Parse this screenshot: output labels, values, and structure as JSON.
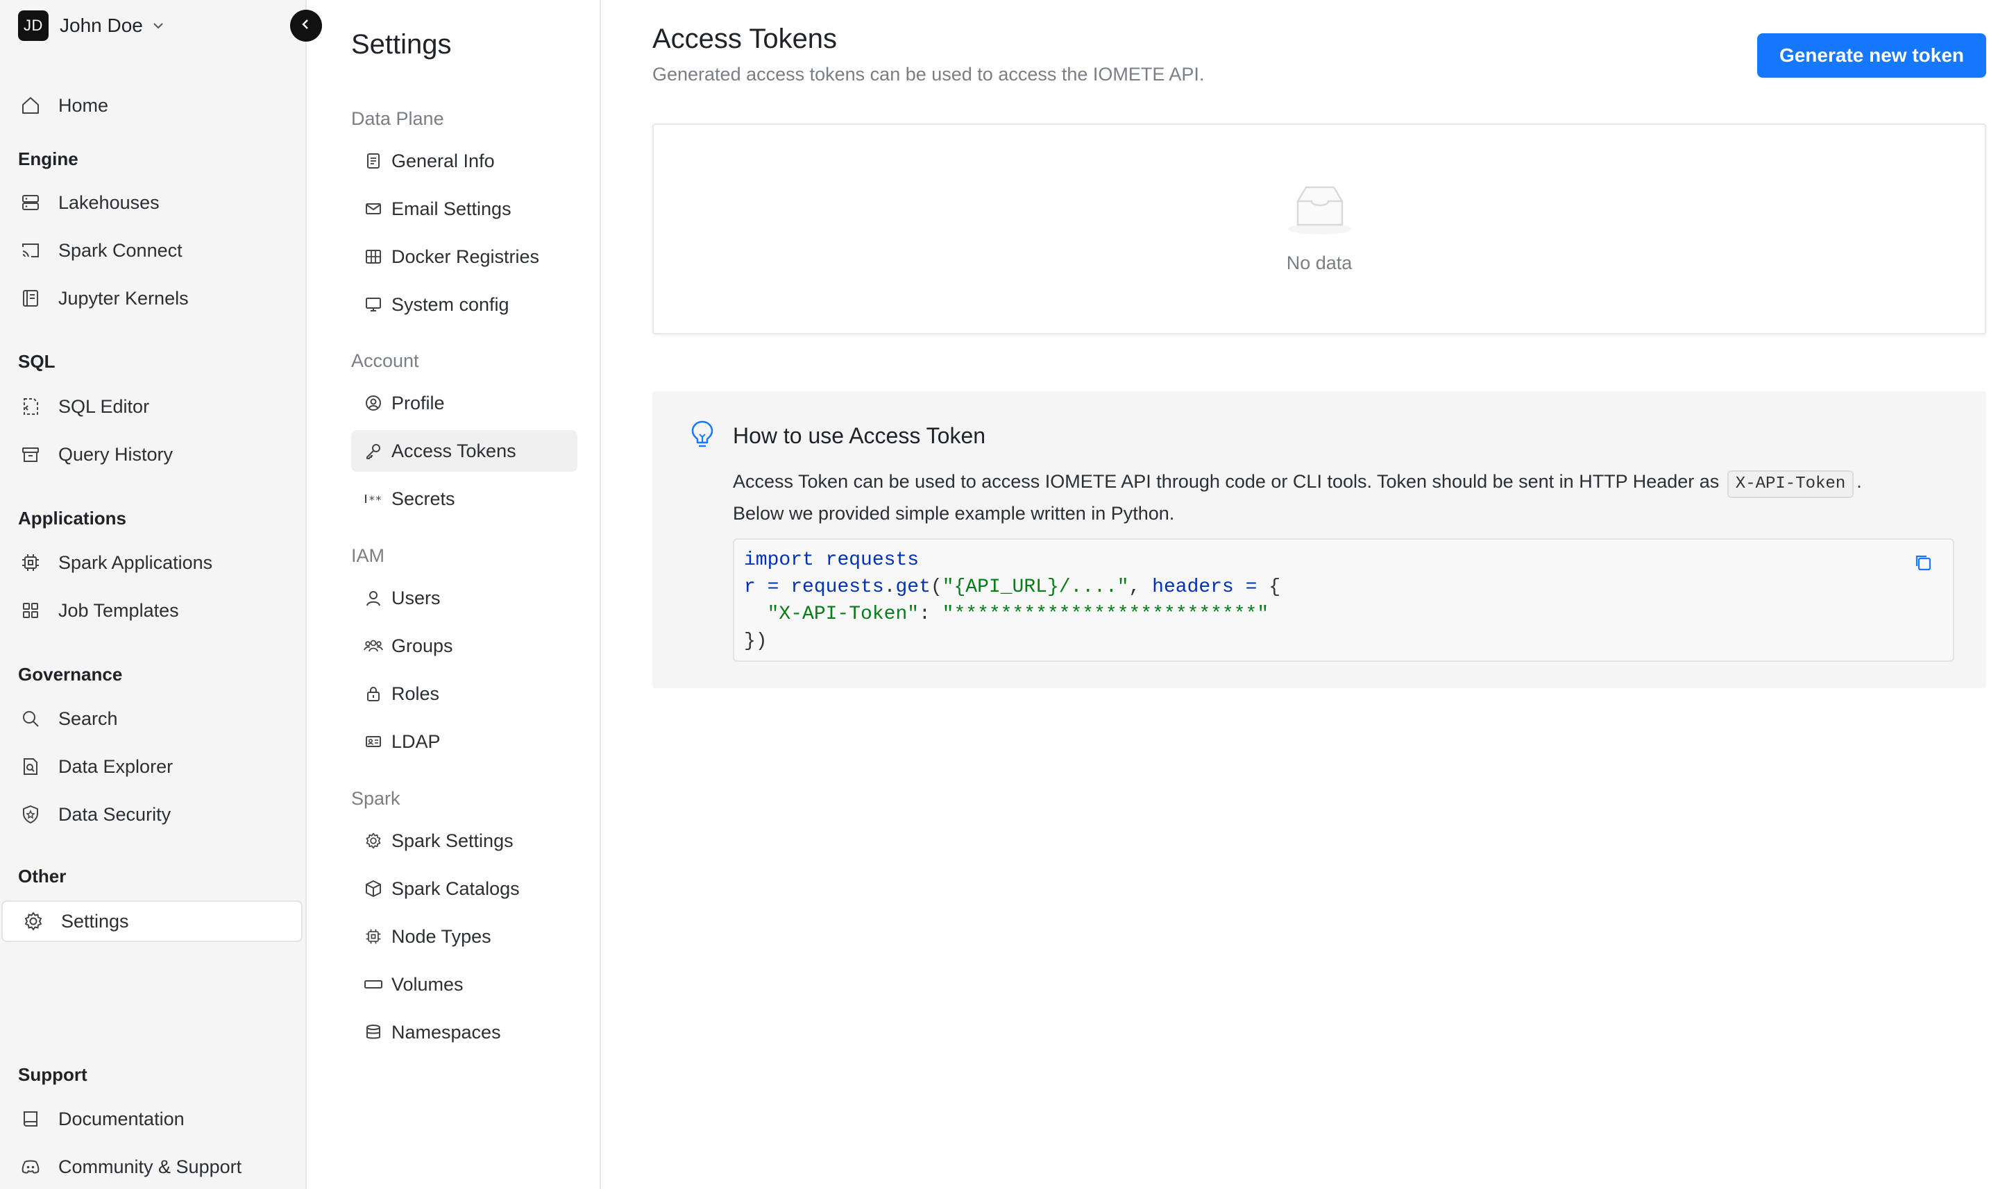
{
  "user": {
    "initials": "JD",
    "name": "John Doe"
  },
  "sidebar": {
    "home": "Home",
    "sections": {
      "engine": "Engine",
      "sql": "SQL",
      "applications": "Applications",
      "governance": "Governance",
      "other": "Other",
      "support": "Support"
    },
    "items": {
      "lakehouses": "Lakehouses",
      "spark_connect": "Spark Connect",
      "jupyter_kernels": "Jupyter Kernels",
      "sql_editor": "SQL Editor",
      "query_history": "Query History",
      "spark_applications": "Spark Applications",
      "job_templates": "Job Templates",
      "search": "Search",
      "data_explorer": "Data Explorer",
      "data_security": "Data Security",
      "settings": "Settings",
      "documentation": "Documentation",
      "community_support": "Community & Support"
    }
  },
  "settings_nav": {
    "title": "Settings",
    "groups": {
      "data_plane": "Data Plane",
      "account": "Account",
      "iam": "IAM",
      "spark": "Spark"
    },
    "items": {
      "general_info": "General Info",
      "email_settings": "Email Settings",
      "docker_registries": "Docker Registries",
      "system_config": "System config",
      "profile": "Profile",
      "access_tokens": "Access Tokens",
      "secrets": "Secrets",
      "users": "Users",
      "groups": "Groups",
      "roles": "Roles",
      "ldap": "LDAP",
      "spark_settings": "Spark Settings",
      "spark_catalogs": "Spark Catalogs",
      "node_types": "Node Types",
      "volumes": "Volumes",
      "namespaces": "Namespaces"
    }
  },
  "main": {
    "title": "Access Tokens",
    "subtitle": "Generated access tokens can be used to access the IOMETE API.",
    "generate_button": "Generate new token",
    "empty_text": "No data",
    "howto": {
      "title": "How to use Access Token",
      "desc_part1": "Access Token can be used to access IOMETE API through code or CLI tools. Token should be sent in HTTP Header as",
      "header_name": "X-API-Token",
      "desc_part2": ".",
      "desc_line2": "Below we provided simple example written in Python.",
      "code": {
        "l1_kw": "import",
        "l1_mod": "requests",
        "l2_var": "r",
        "l2_eq": " = ",
        "l2_obj": "requests",
        "l2_dot": ".",
        "l2_fn": "get",
        "l2_open": "(",
        "l2_str": "\"{API_URL}/....\"",
        "l2_comma": ", ",
        "l2_arg": "headers",
        "l2_eq2": " = ",
        "l2_brace": "{",
        "l3_indent": "  ",
        "l3_key": "\"X-API-Token\"",
        "l3_colon": ": ",
        "l3_val": "\"**************************\"",
        "l4": "})"
      }
    }
  },
  "colors": {
    "primary": "#1677ff",
    "sidebar_bg": "#f5f5f5",
    "howto_bg": "#f5f5f5",
    "text": "#1f2328",
    "muted": "#7a7f85"
  }
}
